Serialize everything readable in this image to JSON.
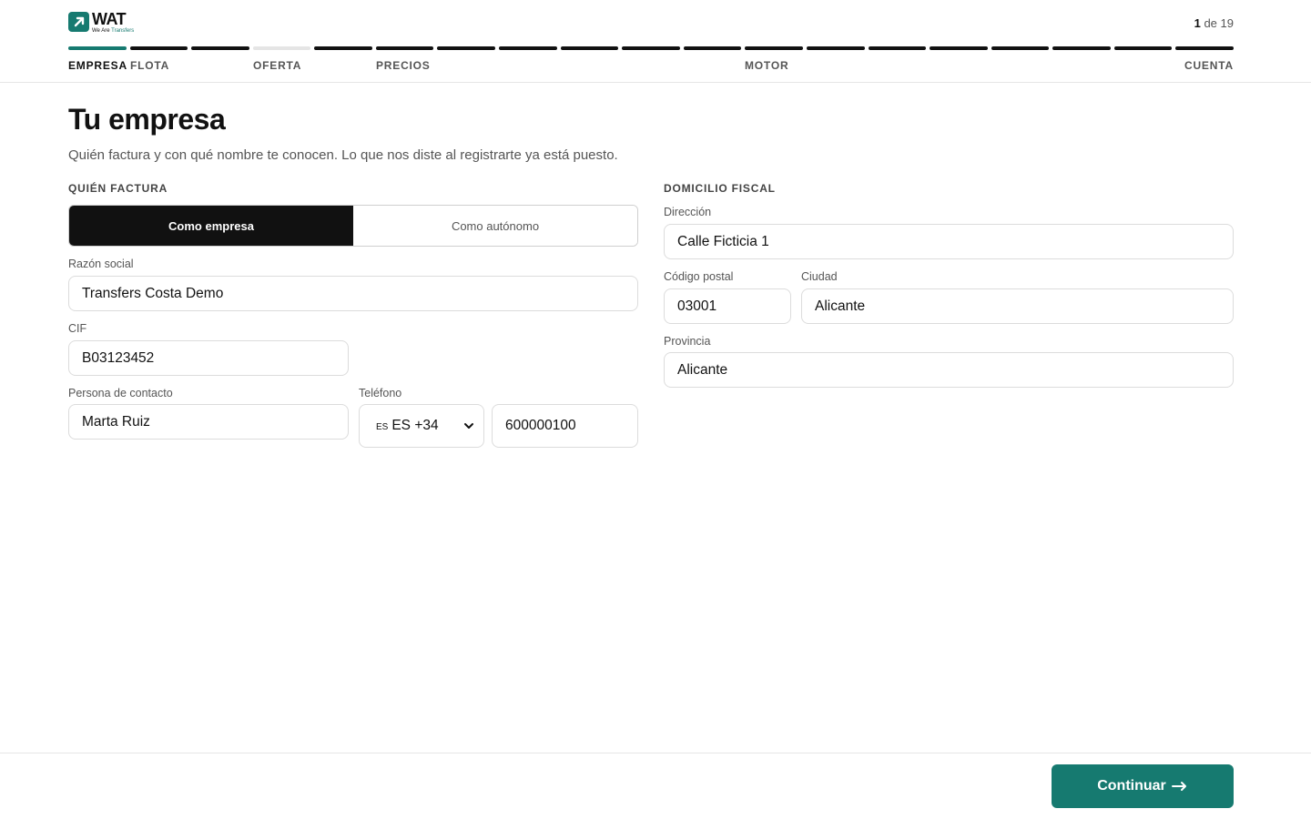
{
  "brand": {
    "name": "WAT",
    "tagline_prefix": "We Are",
    "tagline_accent": "Transfers",
    "accent_color": "#167a70"
  },
  "progress": {
    "current": "1",
    "separator": "de",
    "total": "19",
    "segments_total": 19,
    "active_index": 0,
    "pending_indices": [
      3
    ],
    "labels": {
      "empresa": "EMPRESA",
      "flota": "FLOTA",
      "oferta": "OFERTA",
      "precios": "PRECIOS",
      "motor": "MOTOR",
      "cuenta": "CUENTA"
    }
  },
  "page": {
    "title": "Tu empresa",
    "subtitle": "Quién factura y con qué nombre te conocen. Lo que nos diste al registrarte ya está puesto."
  },
  "billing": {
    "heading": "QUIÉN FACTURA",
    "options": [
      "Como empresa",
      "Como autónomo"
    ],
    "selected": "Como empresa"
  },
  "fields": {
    "razon_social": {
      "label": "Razón social",
      "value": "Transfers Costa Demo"
    },
    "cif": {
      "label": "CIF",
      "value": "B03123452"
    },
    "contacto": {
      "label": "Persona de contacto",
      "value": "Marta Ruiz"
    },
    "telefono": {
      "label": "Teléfono",
      "country_code": "ES",
      "prefix": "ES +34",
      "value": "600000100"
    }
  },
  "fiscal": {
    "heading": "DOMICILIO FISCAL",
    "direccion": {
      "label": "Dirección",
      "value": "Calle Ficticia 1"
    },
    "codigo_postal": {
      "label": "Código postal",
      "value": "03001"
    },
    "ciudad": {
      "label": "Ciudad",
      "value": "Alicante"
    },
    "provincia": {
      "label": "Provincia",
      "value": "Alicante"
    }
  },
  "footer": {
    "continue_label": "Continuar",
    "continue_icon": "arrow-right-icon"
  }
}
